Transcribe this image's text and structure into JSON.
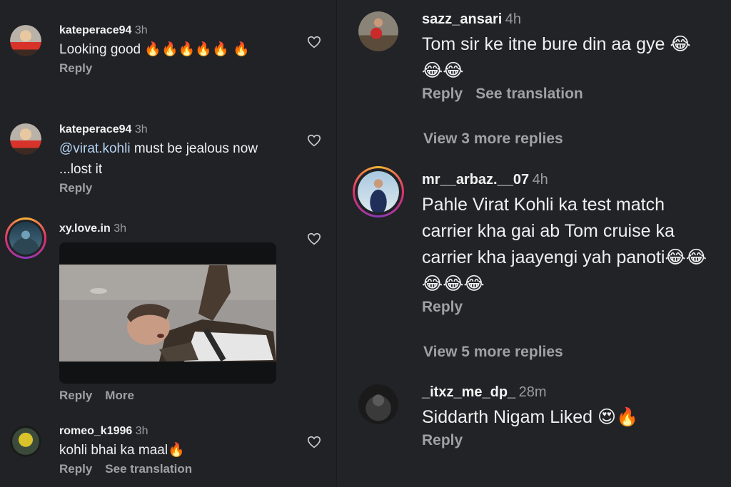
{
  "left_comments": [
    {
      "username": "kateperace94",
      "time": "3h",
      "text": "Looking good 🔥🔥🔥🔥🔥 🔥",
      "actions": [
        "Reply"
      ]
    },
    {
      "username": "kateperace94",
      "time": "3h",
      "mention": "@virat.kohli",
      "text": " must be jealous now ...lost it",
      "actions": [
        "Reply"
      ]
    },
    {
      "username": "xy.love.in",
      "time": "3h",
      "text": "",
      "actions": [
        "Reply",
        "More"
      ]
    },
    {
      "username": "romeo_k1996",
      "time": "3h",
      "text": "kohli bhai ka maal🔥",
      "actions": [
        "Reply",
        "See translation"
      ]
    }
  ],
  "right_comments": [
    {
      "username": "sazz_ansari",
      "time": "4h",
      "text": "Tom sir ke itne bure din aa gye 😂😂😂",
      "actions": [
        "Reply",
        "See translation"
      ],
      "view_more": "View 3 more replies"
    },
    {
      "username": "mr__arbaz.__07",
      "time": "4h",
      "text": "Pahle Virat Kohli ka test match carrier kha gai ab Tom cruise ka carrier kha jaayengi yah panoti😂😂😂😂😂",
      "actions": [
        "Reply"
      ],
      "view_more": "View 5 more replies"
    },
    {
      "username": "_itxz_me_dp_",
      "time": "28m",
      "text": "Siddarth Nigam Liked 😍🔥",
      "actions": [
        "Reply"
      ]
    }
  ],
  "icons": {
    "like": "heart-outline-icon"
  },
  "colors": {
    "background": "#202226",
    "text": "#f0f0f0",
    "muted": "#9fa1a6",
    "mention": "#b6d3f2"
  }
}
